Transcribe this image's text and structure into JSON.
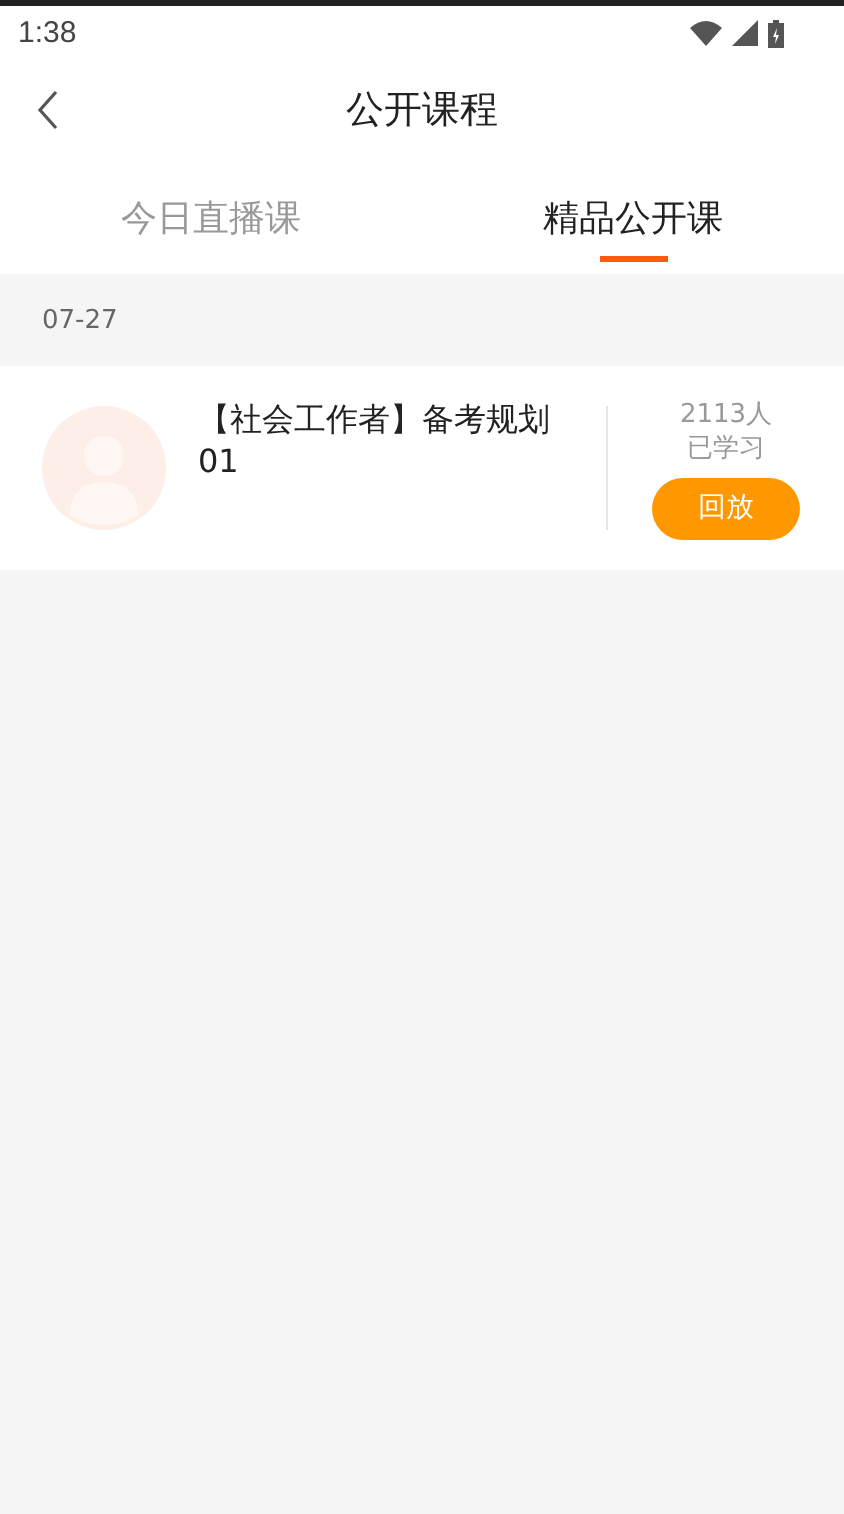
{
  "status_bar": {
    "time": "1:38"
  },
  "header": {
    "title": "公开课程"
  },
  "tabs": [
    {
      "label": "今日直播课",
      "selected": false
    },
    {
      "label": "精品公开课",
      "selected": true
    }
  ],
  "sections": [
    {
      "date": "07-27",
      "courses": [
        {
          "title": "【社会工作者】备考规划01",
          "learners": "2113人",
          "learners_label": "已学习",
          "action": "回放"
        }
      ]
    }
  ]
}
